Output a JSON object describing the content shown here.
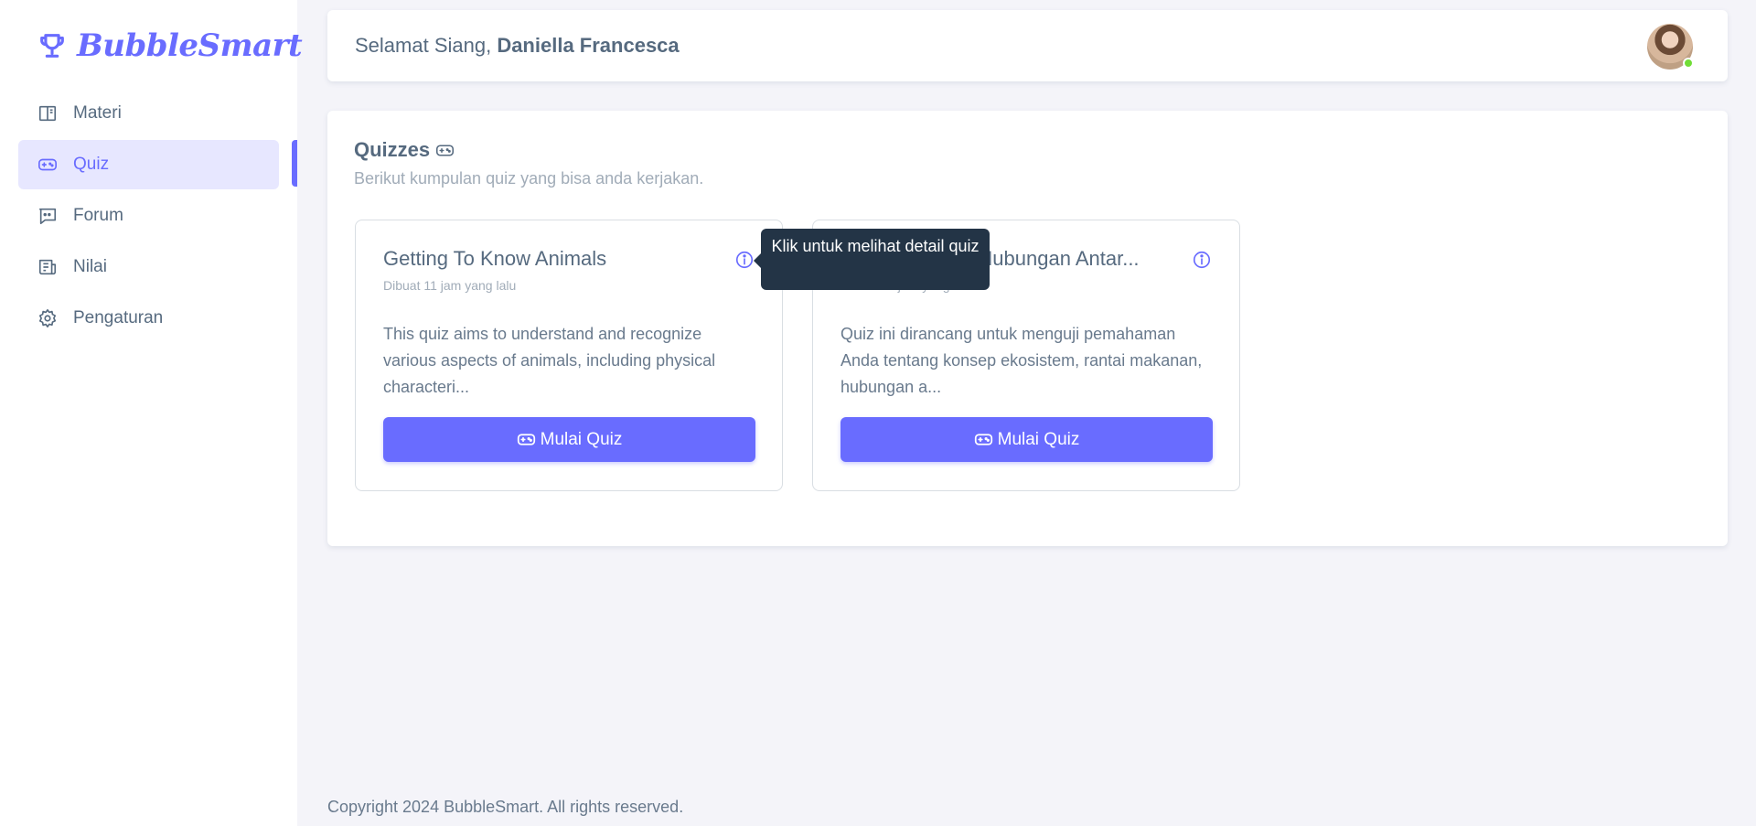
{
  "brand": {
    "name": "BubbleSmart",
    "icon": "trophy-icon",
    "color": "#696cff"
  },
  "sidebar": {
    "items": [
      {
        "label": "Materi",
        "icon": "book-icon",
        "active": false
      },
      {
        "label": "Quiz",
        "icon": "gamepad-icon",
        "active": true
      },
      {
        "label": "Forum",
        "icon": "chat-icon",
        "active": false
      },
      {
        "label": "Nilai",
        "icon": "grade-icon",
        "active": false
      },
      {
        "label": "Pengaturan",
        "icon": "gear-icon",
        "active": false
      }
    ]
  },
  "header": {
    "greeting_prefix": "Selamat Siang, ",
    "user_name": "Daniella Francesca",
    "status": "online"
  },
  "main": {
    "title": "Quizzes",
    "title_icon": "gamepad-icon",
    "subtitle": "Berikut kumpulan quiz yang bisa anda kerjakan.",
    "quizzes": [
      {
        "title": "Getting To Know Animals",
        "created": "Dibuat 11 jam yang lalu",
        "description": "This quiz aims to understand and recognize various aspects of animals, including physical characteri...",
        "button_label": "Mulai Quiz"
      },
      {
        "title": "Ekosistem dan Hubungan Antar...",
        "created": "Dibuat 11 jam yang lalu",
        "description": "Quiz ini dirancang untuk menguji pemahaman Anda tentang konsep ekosistem, rantai makanan, hubungan a...",
        "button_label": "Mulai Quiz"
      }
    ],
    "tooltip": "Klik untuk melihat detail quiz"
  },
  "footer": {
    "text": "Copyright 2024 BubbleSmart. All rights reserved."
  },
  "colors": {
    "primary": "#696cff",
    "active_bg": "#e7e7ff",
    "tooltip_bg": "#233446",
    "online": "#71dd37"
  }
}
